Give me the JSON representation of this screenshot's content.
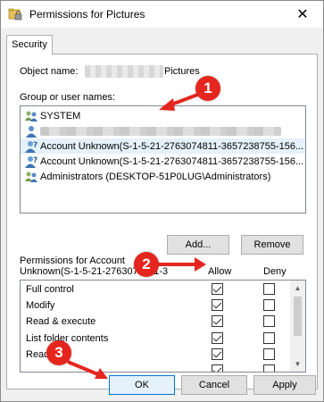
{
  "window": {
    "title": "Permissions for Pictures",
    "close_glyph": "✕"
  },
  "tabs": [
    {
      "label": "Security"
    }
  ],
  "object": {
    "label": "Object name:",
    "value": "Pictures"
  },
  "groups": {
    "label": "Group or user names:",
    "items": [
      {
        "label": "SYSTEM",
        "icon": "users-group-icon",
        "blurred": false,
        "selected": false
      },
      {
        "label": "",
        "icon": "user-icon",
        "blurred": true,
        "selected": false
      },
      {
        "label": "Account Unknown(S-1-5-21-2763074811-3657238755-156...",
        "icon": "unknown-user-icon",
        "blurred": false,
        "selected": true
      },
      {
        "label": "Account Unknown(S-1-5-21-2763074811-3657238755-156...",
        "icon": "unknown-user-icon",
        "blurred": false,
        "selected": false
      },
      {
        "label": "Administrators (DESKTOP-51P0LUG\\Administrators)",
        "icon": "users-group-icon",
        "blurred": false,
        "selected": false
      }
    ]
  },
  "actions": {
    "add_label": "Add...",
    "remove_label": "Remove"
  },
  "permissions": {
    "header_line1": "Permissions for Account",
    "header_line2": "Unknown(S-1-5-21-2763074811-3",
    "allow_label": "Allow",
    "deny_label": "Deny",
    "rows": [
      {
        "label": "Full control",
        "allow": true,
        "deny": false
      },
      {
        "label": "Modify",
        "allow": true,
        "deny": false
      },
      {
        "label": "Read & execute",
        "allow": true,
        "deny": false
      },
      {
        "label": "List folder contents",
        "allow": true,
        "deny": false
      },
      {
        "label": "Read",
        "allow": true,
        "deny": false
      },
      {
        "label": "",
        "allow": true,
        "deny": false
      }
    ]
  },
  "footer": {
    "ok_label": "OK",
    "cancel_label": "Cancel",
    "apply_label": "Apply"
  },
  "annotations": {
    "marker_1": "1",
    "marker_2": "2",
    "marker_3": "3",
    "color": "#e5261e"
  },
  "colors": {
    "selection": "#e5f1fb",
    "default_button_border": "#0078d7",
    "dialog_background": "#f0f0f0"
  }
}
